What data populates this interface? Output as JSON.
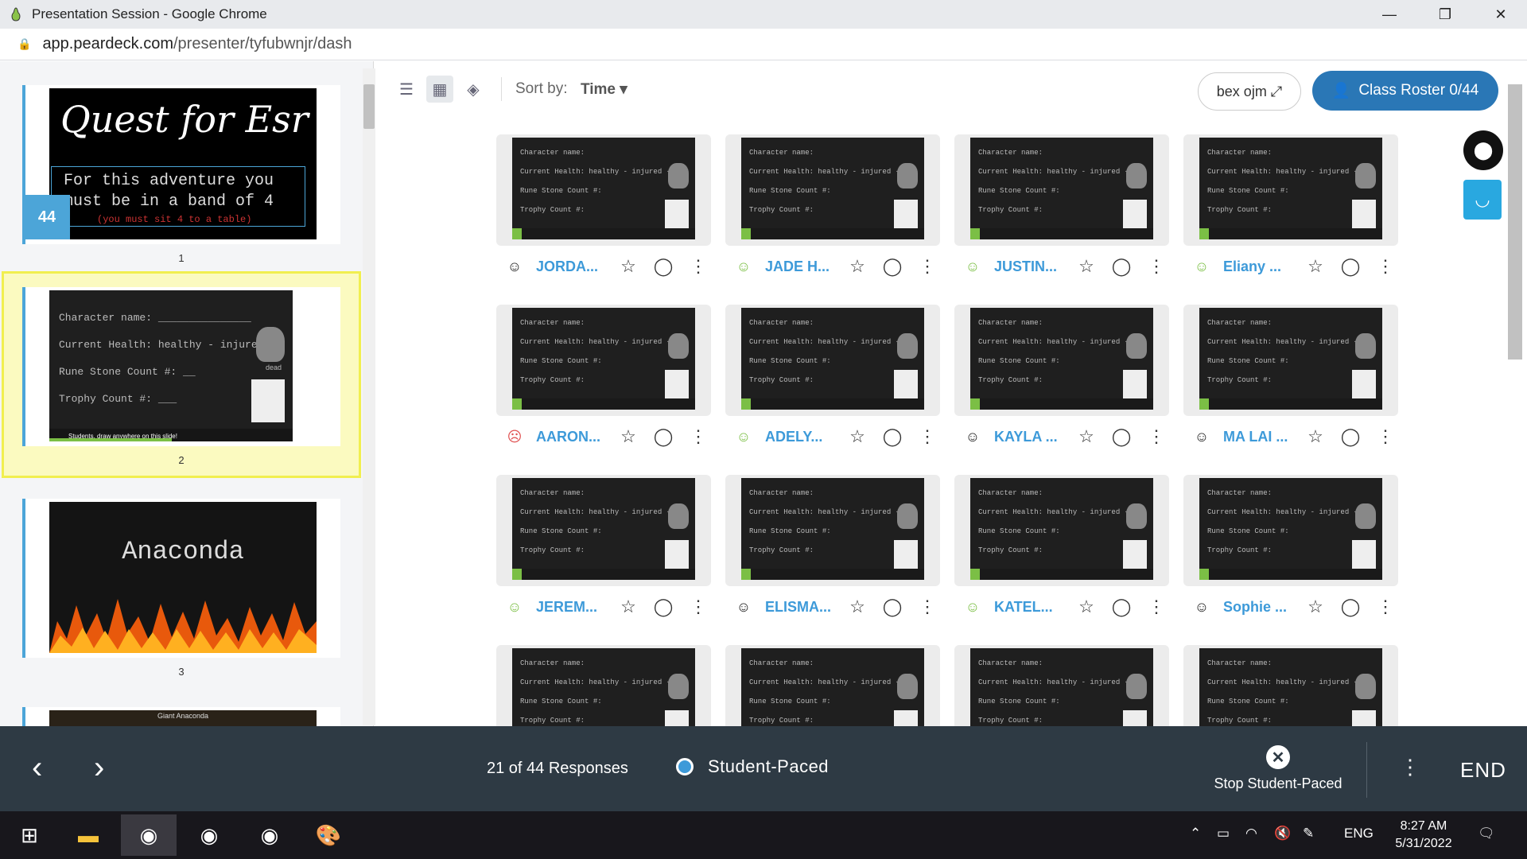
{
  "window": {
    "title": "Presentation Session - Google Chrome",
    "minimize": "—",
    "maximize": "❐",
    "close": "✕"
  },
  "address": {
    "host": "app.peardeck.com",
    "path": "/presenter/tyfubwnjr/dash"
  },
  "sidebar": {
    "badge": "44",
    "slides": [
      {
        "num": "1",
        "title": "Quest for Esr",
        "body": "For this adventure you must be in a band of 4",
        "note": "(you must sit 4 to a table)"
      },
      {
        "num": "2",
        "lines": [
          "Character name: _______________",
          "Current Health: healthy - injured -",
          "Rune Stone Count #: __",
          "Trophy Count #: ___"
        ],
        "dead": "dead",
        "footer": "Students, draw anywhere on this slide!"
      },
      {
        "num": "3",
        "title": "Anaconda"
      },
      {
        "num": "4",
        "title": "Giant Anaconda"
      }
    ]
  },
  "toolbar": {
    "sort_label": "Sort by:",
    "sort_value": "Time ▾",
    "name_button": "bex ojm ⤢",
    "roster_button": "Class Roster 0/44"
  },
  "slide_text": {
    "name": "Character name:",
    "health": "Current Health:",
    "health_opts": "healthy - injured -",
    "rune": "Rune Stone Count #:",
    "trophy": "Trophy Count #:",
    "dead": "dead"
  },
  "students": [
    {
      "name": "JORDA...",
      "mood": "neutral"
    },
    {
      "name": "JADE H...",
      "mood": "happy"
    },
    {
      "name": "JUSTIN...",
      "mood": "happy"
    },
    {
      "name": "Eliany ...",
      "mood": "happy"
    },
    {
      "name": "AARON...",
      "mood": "sad"
    },
    {
      "name": "ADELY...",
      "mood": "happy"
    },
    {
      "name": "KAYLA ...",
      "mood": "neutral"
    },
    {
      "name": "MA LAI ...",
      "mood": "neutral"
    },
    {
      "name": "JEREM...",
      "mood": "happy"
    },
    {
      "name": "ELISMA...",
      "mood": "neutral"
    },
    {
      "name": "KATEL...",
      "mood": "happy"
    },
    {
      "name": "Sophie ...",
      "mood": "neutral"
    },
    {
      "name": "",
      "mood": "none"
    },
    {
      "name": "",
      "mood": "none"
    },
    {
      "name": "",
      "mood": "none"
    },
    {
      "name": "",
      "mood": "none"
    }
  ],
  "bottom": {
    "responses": "21 of 44 Responses",
    "mode": "Student-Paced",
    "stop": "Stop Student-Paced",
    "end": "END"
  },
  "taskbar": {
    "lang": "ENG",
    "time": "8:27 AM",
    "date": "5/31/2022"
  },
  "colors": {
    "accent": "#3d9ad9",
    "roster": "#2a77b6",
    "bottom": "#2e3a44",
    "selected": "#f1ef4f"
  }
}
